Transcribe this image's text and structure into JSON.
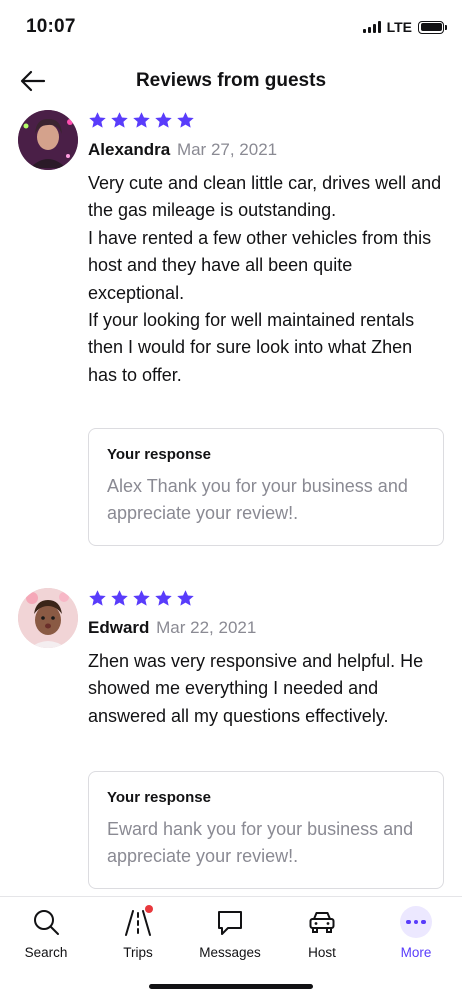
{
  "status_bar": {
    "time": "10:07",
    "network": "LTE",
    "battery_level": 1.0
  },
  "header": {
    "title": "Reviews from guests",
    "back_icon": "arrow-left-icon"
  },
  "colors": {
    "accent": "#593cfb",
    "star": "#593cfb",
    "muted_text": "#8a8a93",
    "notification_dot": "#e8383d"
  },
  "reviews": [
    {
      "rating": 5,
      "name": "Alexandra",
      "date": "Mar 27, 2021",
      "text_lines": [
        "Very cute and clean little car, drives well and the gas mileage is outstanding.",
        "I have rented a few other vehicles from this host and they have all been quite exceptional.",
        "If your looking for well maintained rentals then I would for sure look into what Zhen has to offer."
      ],
      "response": {
        "label": "Your response",
        "text": "Alex Thank you for your business and appreciate your review!."
      }
    },
    {
      "rating": 5,
      "name": "Edward",
      "date": "Mar 22, 2021",
      "text_lines": [
        "Zhen was very responsive and helpful. He showed me everything I needed and answered all my questions effectively."
      ],
      "response": {
        "label": "Your response",
        "text": "Eward hank you for your business and appreciate your review!."
      }
    }
  ],
  "bottom_nav": [
    {
      "label": "Search",
      "icon": "search-icon",
      "active": false
    },
    {
      "label": "Trips",
      "icon": "road-icon",
      "active": false,
      "badge": true
    },
    {
      "label": "Messages",
      "icon": "chat-bubble-icon",
      "active": false
    },
    {
      "label": "Host",
      "icon": "car-icon",
      "active": false
    },
    {
      "label": "More",
      "icon": "more-dots-icon",
      "active": true
    }
  ]
}
